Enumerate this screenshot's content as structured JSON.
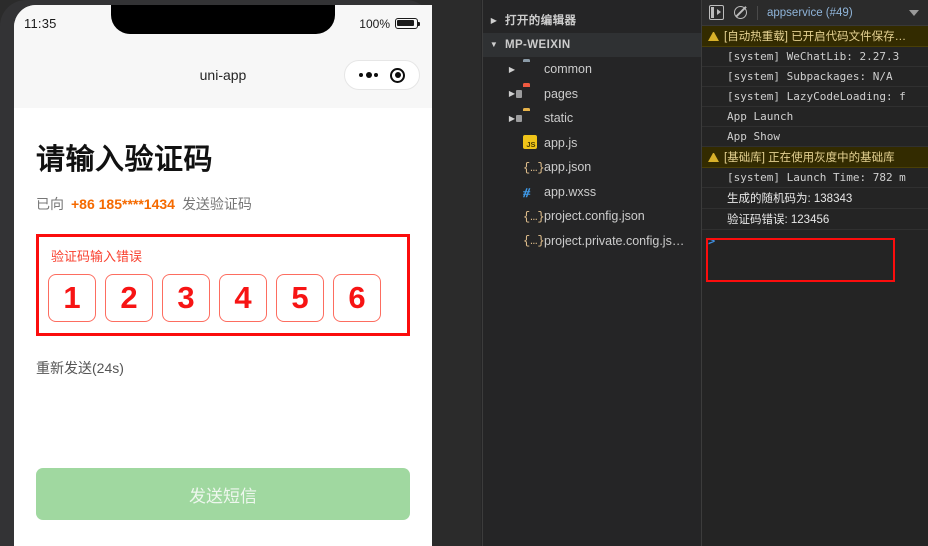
{
  "simulator": {
    "status_bar": {
      "time": "11:35",
      "battery_label": "100%",
      "battery_icon": "battery-full-icon"
    },
    "nav": {
      "title": "uni-app",
      "capsule_menu_icon": "more-dots-icon",
      "capsule_target_icon": "target-circle-icon"
    },
    "page": {
      "title": "请输入验证码",
      "sent_prefix": "已向",
      "phone": "+86 185****1434",
      "sent_suffix": "发送验证码",
      "error_text": "验证码输入错误",
      "code_digits": [
        "1",
        "2",
        "3",
        "4",
        "5",
        "6"
      ],
      "resend": "重新发送(24s)",
      "submit_label": "发送短信"
    },
    "colors": {
      "phone_accent": "#f56a00",
      "error_red": "#fb0d0d",
      "submit_green": "#a0d8a0"
    }
  },
  "explorer": {
    "rows": [
      {
        "label": "打开的编辑器",
        "kind": "section",
        "twisty": "collapsed",
        "indent": 0,
        "icon": "none",
        "selected": false
      },
      {
        "label": "MP-WEIXIN",
        "kind": "section",
        "twisty": "expanded",
        "indent": 0,
        "icon": "none",
        "selected": true
      },
      {
        "label": "common",
        "kind": "folder",
        "twisty": "collapsed",
        "indent": 1,
        "icon": "folder-grey-icon",
        "selected": false
      },
      {
        "label": "pages",
        "kind": "folder",
        "twisty": "collapsed",
        "indent": 1,
        "icon": "folder-red-icon",
        "selected": false
      },
      {
        "label": "static",
        "kind": "folder",
        "twisty": "collapsed",
        "indent": 1,
        "icon": "folder-yellow-icon",
        "selected": false
      },
      {
        "label": "app.js",
        "kind": "file",
        "twisty": "none",
        "indent": 1,
        "icon": "js-file-icon",
        "selected": false
      },
      {
        "label": "app.json",
        "kind": "file",
        "twisty": "none",
        "indent": 1,
        "icon": "json-file-icon",
        "selected": false
      },
      {
        "label": "app.wxss",
        "kind": "file",
        "twisty": "none",
        "indent": 1,
        "icon": "wxss-file-icon",
        "selected": false
      },
      {
        "label": "project.config.json",
        "kind": "file",
        "twisty": "none",
        "indent": 1,
        "icon": "json-file-icon",
        "selected": false
      },
      {
        "label": "project.private.config.js…",
        "kind": "file",
        "twisty": "none",
        "indent": 1,
        "icon": "json-file-icon",
        "selected": false
      }
    ]
  },
  "console": {
    "toolbar": {
      "panel_toggle_icon": "panel-toggle-icon",
      "clear_icon": "clear-console-icon",
      "context_label": "appservice (#49)",
      "dropdown_icon": "chevron-down-icon"
    },
    "logs": [
      {
        "text": "[自动热重载] 已开启代码文件保存…",
        "level": "warn",
        "script": "zh"
      },
      {
        "text": "[system] WeChatLib: 2.27.3",
        "level": "info",
        "script": "mono"
      },
      {
        "text": "[system] Subpackages: N/A",
        "level": "info",
        "script": "mono"
      },
      {
        "text": "[system] LazyCodeLoading: f",
        "level": "info",
        "script": "mono"
      },
      {
        "text": "App Launch",
        "level": "info",
        "script": "mono"
      },
      {
        "text": "App Show",
        "level": "info",
        "script": "mono"
      },
      {
        "text": "[基础库] 正在使用灰度中的基础库",
        "level": "warn",
        "script": "zh"
      },
      {
        "text": "[system] Launch Time: 782 m",
        "level": "info",
        "script": "mono"
      },
      {
        "text": "生成的随机码为: 138343",
        "level": "info",
        "script": "zh"
      },
      {
        "text": "验证码错误:  123456",
        "level": "info",
        "script": "zh"
      }
    ],
    "prompt": ">",
    "highlight_color": "#fb0d0d"
  }
}
